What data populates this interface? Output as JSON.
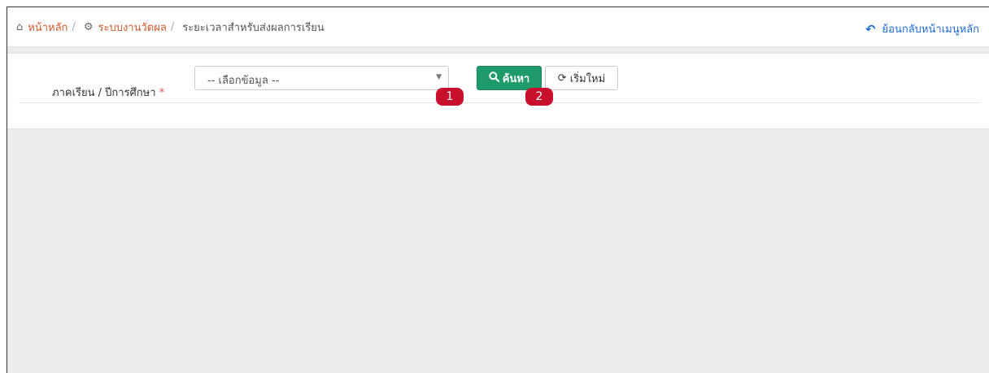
{
  "breadcrumb": {
    "home_label": "หน้าหลัก",
    "home_icon": "home-icon",
    "system_label": "ระบบงานวัดผล",
    "system_icon": "gears-icon",
    "separator": "/",
    "current_label": "ระยะเวลาสำหรับส่งผลการเรียน"
  },
  "back_link": {
    "label": "ย้อนกลับหน้าเมนูหลัก",
    "icon": "undo-icon"
  },
  "filter": {
    "semester_label": "ภาคเรียน / ปีการศึกษา",
    "required_marker": "*",
    "select_value": "-- เลือกข้อมูล --"
  },
  "buttons": {
    "search_label": "ค้นหา",
    "search_icon": "search-icon",
    "reset_label": "เริ่มใหม่",
    "reset_icon": "refresh-icon"
  },
  "annotations": {
    "badge_1": "1",
    "badge_2": "2"
  },
  "colors": {
    "link": "#d05a2f",
    "back_link": "#1e6bd6",
    "search_button": "#1e9a6b",
    "badge": "#c8102e",
    "content_bg": "#ececec"
  }
}
